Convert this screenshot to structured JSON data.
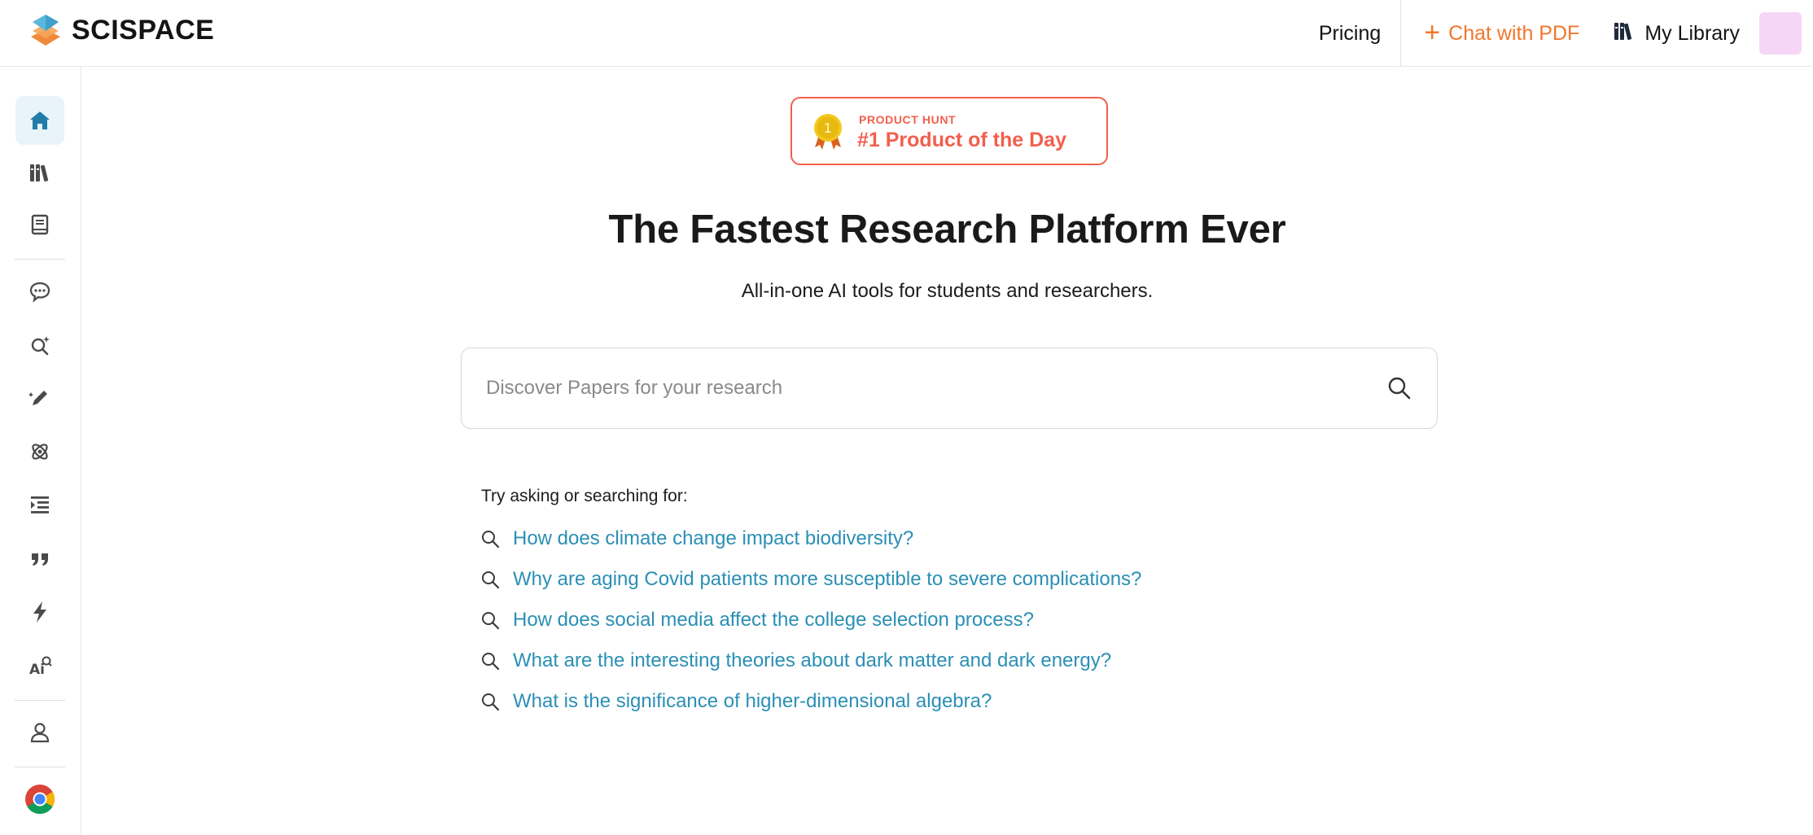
{
  "brand": {
    "name": "SCISPACE"
  },
  "nav": {
    "pricing": "Pricing",
    "chat_pdf": "Chat with PDF",
    "chat_pdf_icon": "plus-icon",
    "library": "My Library",
    "library_icon": "books-icon"
  },
  "sidebar": {
    "items": [
      {
        "name": "home",
        "icon": "home-icon",
        "active": true
      },
      {
        "name": "library",
        "icon": "books-icon"
      },
      {
        "name": "notebook",
        "icon": "notebook-icon"
      },
      {
        "name": "chat",
        "icon": "chat-bubble-icon"
      },
      {
        "name": "literature-review",
        "icon": "search-sparkle-icon"
      },
      {
        "name": "writer",
        "icon": "pen-icon"
      },
      {
        "name": "extract-data",
        "icon": "atom-icon"
      },
      {
        "name": "paraphraser",
        "icon": "indent-list-icon"
      },
      {
        "name": "citation",
        "icon": "quote-icon"
      },
      {
        "name": "ai-detector",
        "icon": "lightning-icon"
      },
      {
        "name": "ai-writer",
        "icon": "ai-search-icon"
      },
      {
        "name": "profile",
        "icon": "user-icon"
      },
      {
        "name": "chrome-extension",
        "icon": "chrome-icon"
      }
    ]
  },
  "badge": {
    "kicker": "PRODUCT HUNT",
    "title": "#1 Product of the Day",
    "medal_number": "1",
    "color": "#f25f4c"
  },
  "hero": {
    "title": "The Fastest Research Platform Ever",
    "subtitle": "All-in-one AI tools for students and researchers."
  },
  "search": {
    "placeholder": "Discover Papers for your research",
    "value": ""
  },
  "suggestions": {
    "label": "Try asking or searching for:",
    "items": [
      "How does climate change impact biodiversity?",
      "Why are aging Covid patients more susceptible to severe complications?",
      "How does social media affect the college selection process?",
      "What are the interesting theories about dark matter and dark energy?",
      "What is the significance of higher-dimensional algebra?"
    ]
  },
  "colors": {
    "accent_orange": "#f3762b",
    "link_blue": "#2b8fb4",
    "active_blue": "#1f7da8",
    "badge_red": "#f25f4c",
    "avatar": "#f5d6f7"
  }
}
